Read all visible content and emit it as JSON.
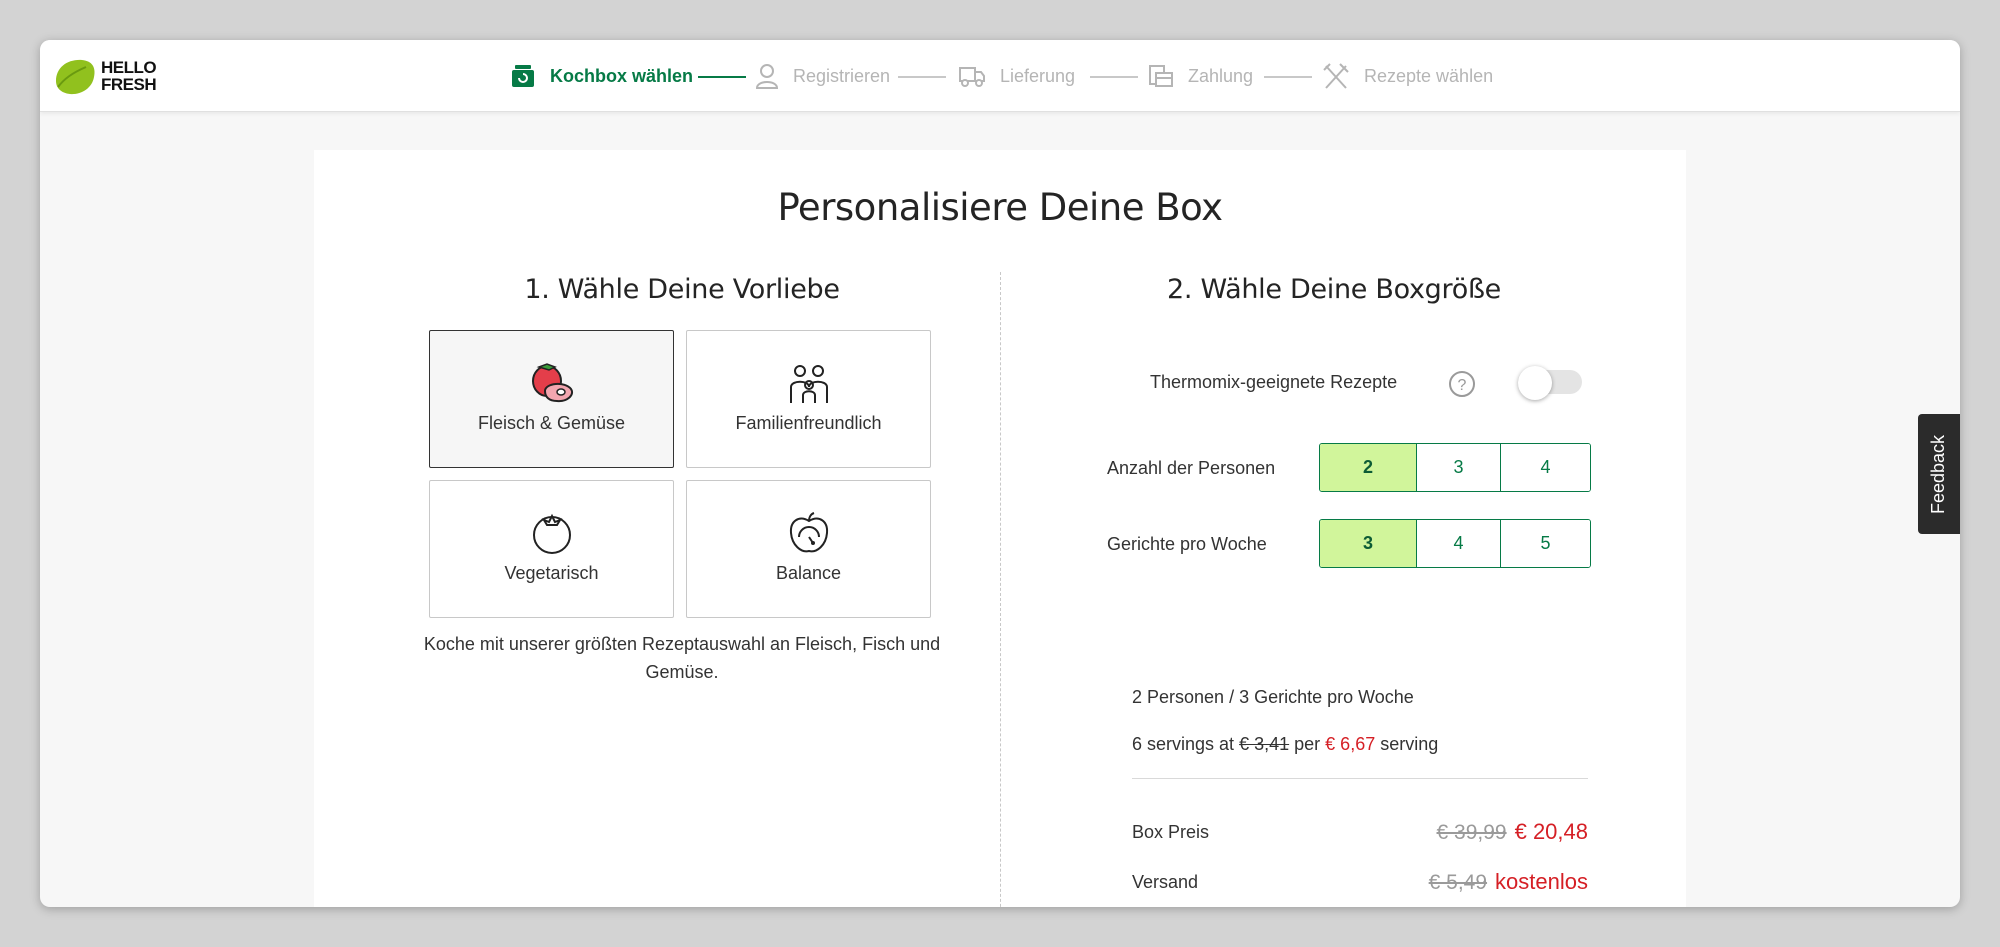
{
  "brand": {
    "logo_line1": "HELLO",
    "logo_line2": "FRESH"
  },
  "steps": [
    {
      "label": "Kochbox wählen",
      "icon": "box-icon",
      "active": true
    },
    {
      "label": "Registrieren",
      "icon": "person-icon",
      "active": false
    },
    {
      "label": "Lieferung",
      "icon": "truck-icon",
      "active": false
    },
    {
      "label": "Zahlung",
      "icon": "wallet-icon",
      "active": false
    },
    {
      "label": "Rezepte wählen",
      "icon": "cutlery-icon",
      "active": false
    }
  ],
  "page_title": "Personalisiere Deine Box",
  "preference": {
    "heading": "1. Wähle Deine Vorliebe",
    "options": [
      {
        "label": "Fleisch & Gemüse",
        "icon": "meat-vegetable-icon",
        "selected": true
      },
      {
        "label": "Familienfreundlich",
        "icon": "family-icon",
        "selected": false
      },
      {
        "label": "Vegetarisch",
        "icon": "tomato-icon",
        "selected": false
      },
      {
        "label": "Balance",
        "icon": "apple-scale-icon",
        "selected": false
      }
    ],
    "description": "Koche mit unserer größten Rezeptauswahl an Fleisch, Fisch und Gemüse."
  },
  "boxsize": {
    "heading": "2. Wähle Deine Boxgröße",
    "thermomix_label": "Thermomix-geeignete Rezepte",
    "help_symbol": "?",
    "thermomix_on": false,
    "persons_label": "Anzahl der Personen",
    "persons_options": [
      "2",
      "3",
      "4"
    ],
    "persons_selected": "2",
    "meals_label": "Gerichte pro Woche",
    "meals_options": [
      "3",
      "4",
      "5"
    ],
    "meals_selected": "3"
  },
  "summary": {
    "line1": "2 Personen / 3 Gerichte pro Woche",
    "servings_prefix": "6 servings at",
    "old_serving_price": "€ 3,41",
    "per_word": "per",
    "new_serving_price": "€ 6,67",
    "servings_suffix": "serving",
    "box_price_label": "Box Preis",
    "box_price_old": "€ 39,99",
    "box_price_new": "€ 20,48",
    "shipping_label": "Versand",
    "shipping_old": "€ 5,49",
    "shipping_new": "kostenlos"
  },
  "feedback_label": "Feedback",
  "colors": {
    "brand_green": "#067a46",
    "lime_selected": "#d1f59b",
    "price_red": "#d51f25",
    "logo_green": "#91c11e"
  }
}
